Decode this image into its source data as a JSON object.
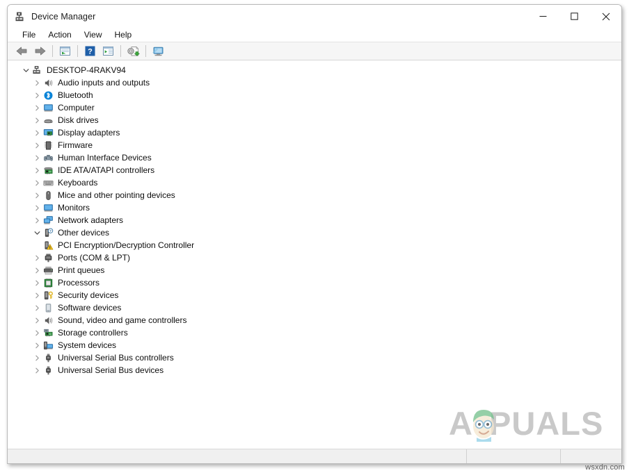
{
  "window": {
    "title": "Device Manager",
    "icon": "device-manager-icon",
    "controls": {
      "minimize": "minimize-button",
      "maximize": "maximize-button",
      "close": "close-button"
    }
  },
  "menubar": {
    "items": [
      {
        "label": "File"
      },
      {
        "label": "Action"
      },
      {
        "label": "View"
      },
      {
        "label": "Help"
      }
    ]
  },
  "toolbar": {
    "buttons": [
      {
        "name": "back-button",
        "icon": "back-arrow-icon"
      },
      {
        "name": "forward-button",
        "icon": "forward-arrow-icon"
      },
      {
        "name": "properties-button",
        "icon": "properties-icon"
      },
      {
        "name": "help-button",
        "icon": "help-question-icon"
      },
      {
        "name": "show-hide-console-tree-button",
        "icon": "console-tree-icon"
      },
      {
        "name": "update-driver-button",
        "icon": "update-driver-icon"
      },
      {
        "name": "scan-for-hardware-changes-button",
        "icon": "scan-hardware-icon"
      }
    ]
  },
  "tree": {
    "root": {
      "label": "DESKTOP-4RAKV94",
      "icon": "computer-root-icon",
      "expanded": true,
      "depth": 0
    },
    "nodes": [
      {
        "label": "Audio inputs and outputs",
        "icon": "speaker-icon",
        "expanded": false,
        "depth": 1
      },
      {
        "label": "Bluetooth",
        "icon": "bluetooth-icon",
        "expanded": false,
        "depth": 1
      },
      {
        "label": "Computer",
        "icon": "monitor-icon",
        "expanded": false,
        "depth": 1
      },
      {
        "label": "Disk drives",
        "icon": "disk-drive-icon",
        "expanded": false,
        "depth": 1
      },
      {
        "label": "Display adapters",
        "icon": "display-adapter-icon",
        "expanded": false,
        "depth": 1
      },
      {
        "label": "Firmware",
        "icon": "firmware-chip-icon",
        "expanded": false,
        "depth": 1
      },
      {
        "label": "Human Interface Devices",
        "icon": "gamepad-icon",
        "expanded": false,
        "depth": 1
      },
      {
        "label": "IDE ATA/ATAPI controllers",
        "icon": "ide-controller-icon",
        "expanded": false,
        "depth": 1
      },
      {
        "label": "Keyboards",
        "icon": "keyboard-icon",
        "expanded": false,
        "depth": 1
      },
      {
        "label": "Mice and other pointing devices",
        "icon": "mouse-icon",
        "expanded": false,
        "depth": 1
      },
      {
        "label": "Monitors",
        "icon": "monitor-icon",
        "expanded": false,
        "depth": 1
      },
      {
        "label": "Network adapters",
        "icon": "network-adapter-icon",
        "expanded": false,
        "depth": 1
      },
      {
        "label": "Other devices",
        "icon": "unknown-device-icon",
        "expanded": true,
        "depth": 1
      },
      {
        "label": "PCI Encryption/Decryption Controller",
        "icon": "warning-device-icon",
        "expanded": null,
        "depth": 2
      },
      {
        "label": "Ports (COM & LPT)",
        "icon": "port-icon",
        "expanded": false,
        "depth": 1
      },
      {
        "label": "Print queues",
        "icon": "printer-icon",
        "expanded": false,
        "depth": 1
      },
      {
        "label": "Processors",
        "icon": "processor-icon",
        "expanded": false,
        "depth": 1
      },
      {
        "label": "Security devices",
        "icon": "security-device-icon",
        "expanded": false,
        "depth": 1
      },
      {
        "label": "Software devices",
        "icon": "software-device-icon",
        "expanded": false,
        "depth": 1
      },
      {
        "label": "Sound, video and game controllers",
        "icon": "speaker-icon",
        "expanded": false,
        "depth": 1
      },
      {
        "label": "Storage controllers",
        "icon": "storage-controller-icon",
        "expanded": false,
        "depth": 1
      },
      {
        "label": "System devices",
        "icon": "system-device-icon",
        "expanded": false,
        "depth": 1
      },
      {
        "label": "Universal Serial Bus controllers",
        "icon": "usb-icon",
        "expanded": false,
        "depth": 1
      },
      {
        "label": "Universal Serial Bus devices",
        "icon": "usb-icon",
        "expanded": false,
        "depth": 1
      }
    ]
  },
  "statusbar": {
    "pane1": "",
    "pane2": "",
    "pane3": ""
  },
  "watermark": {
    "text": "APPUALS",
    "color": "#c9c9c9"
  },
  "sitemark": {
    "text": "wsxdn.com"
  },
  "colors": {
    "accent_blue": "#0a84d8",
    "warning_yellow": "#f2c11b",
    "window_bg": "#ffffff",
    "toolbar_bg": "#f6f6f6",
    "status_bg": "#f0f0f0"
  }
}
